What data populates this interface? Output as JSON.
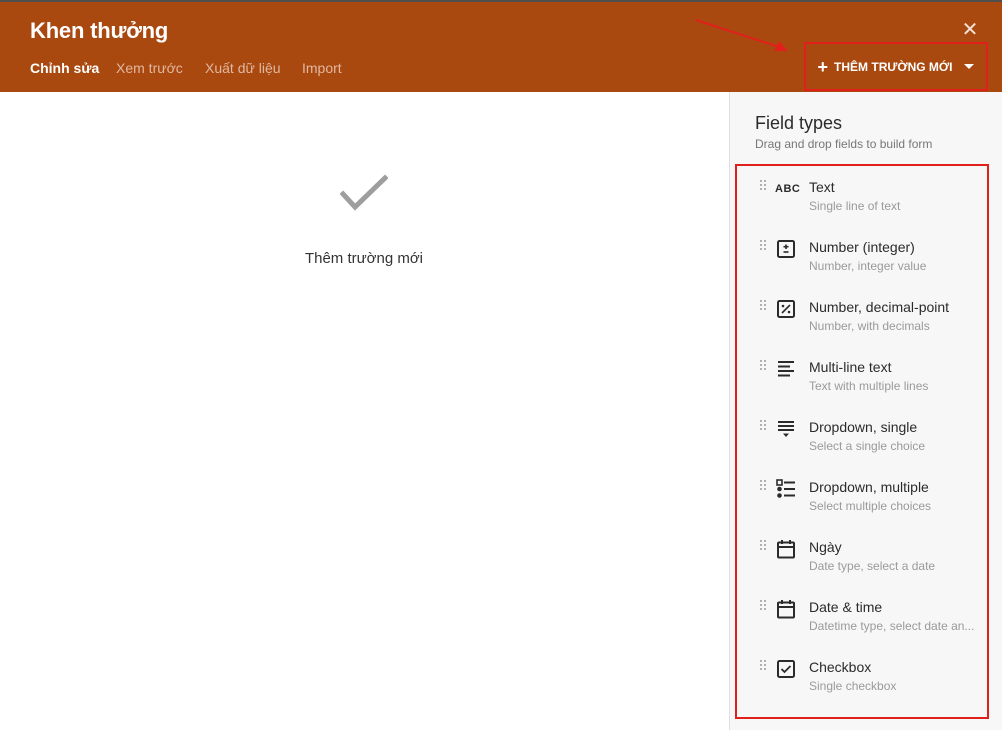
{
  "header": {
    "title": "Khen thưởng",
    "close_icon": "close-icon",
    "tabs": [
      {
        "label": "Chỉnh sửa",
        "active": true
      },
      {
        "label": "Xem trước",
        "active": false
      },
      {
        "label": "Xuất dữ liệu",
        "active": false
      },
      {
        "label": "Import",
        "active": false
      }
    ],
    "add_button": {
      "label": "THÊM TRƯỜNG MỚI",
      "icon": "plus-icon",
      "caret": "caret-down-icon"
    }
  },
  "main": {
    "empty_state": {
      "icon": "checkmark-icon",
      "text": "Thêm trường mới"
    }
  },
  "panel": {
    "title": "Field types",
    "subtitle": "Drag and drop fields to build form",
    "fields": [
      {
        "name": "Text",
        "desc": "Single line of text",
        "icon": "abc-icon",
        "icon_text": "ABC"
      },
      {
        "name": "Number (integer)",
        "desc": "Number, integer value",
        "icon": "plus-minus-box-icon"
      },
      {
        "name": "Number, decimal-point",
        "desc": "Number, with decimals",
        "icon": "percent-box-icon"
      },
      {
        "name": "Multi-line text",
        "desc": "Text with multiple lines",
        "icon": "lines-icon"
      },
      {
        "name": "Dropdown, single",
        "desc": "Select a single choice",
        "icon": "dropdown-list-icon"
      },
      {
        "name": "Dropdown, multiple",
        "desc": "Select multiple choices",
        "icon": "bullet-list-icon"
      },
      {
        "name": "Ngày",
        "desc": "Date type, select a date",
        "icon": "calendar-icon"
      },
      {
        "name": "Date & time",
        "desc": "Datetime type, select date an...",
        "icon": "calendar-icon"
      },
      {
        "name": "Checkbox",
        "desc": "Single checkbox",
        "icon": "checkbox-icon"
      }
    ]
  },
  "colors": {
    "header_bg": "#a9490f",
    "highlight": "#e0201b",
    "panel_bg": "#f7f7f7"
  }
}
